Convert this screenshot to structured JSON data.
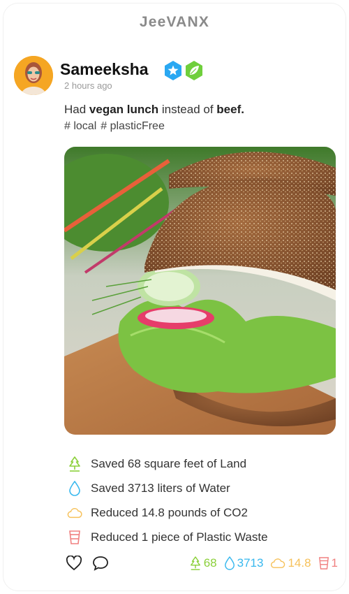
{
  "app": {
    "title": "JeeVANX"
  },
  "post": {
    "author": "Sameeksha",
    "time": "2 hours ago",
    "text_parts": {
      "p1": "Had ",
      "p2": "vegan lunch",
      "p3": " instead of ",
      "p4": "beef."
    },
    "hashtags": [
      "# local",
      "# plasticFree"
    ],
    "badges": [
      "star-badge-icon",
      "leaf-badge-icon"
    ],
    "image_alt": "vegan sandwich"
  },
  "impact": [
    {
      "icon": "tree-icon",
      "text": "Saved 68 square feet of Land"
    },
    {
      "icon": "water-drop-icon",
      "text": "Saved 3713 liters of Water"
    },
    {
      "icon": "cloud-icon",
      "text": "Reduced 14.8 pounds of CO2"
    },
    {
      "icon": "cup-icon",
      "text": "Reduced 1 piece of Plastic Waste"
    }
  ],
  "stats": {
    "land": "68",
    "water": "3713",
    "co2": "14.8",
    "plastic": "1"
  },
  "colors": {
    "green": "#8bd03a",
    "blue": "#38b8ee",
    "yellow": "#f6c15a",
    "red": "#f08080",
    "badge_blue": "#2aa8f2",
    "badge_green": "#6fcf3c",
    "avatar_bg": "#f5a623"
  }
}
